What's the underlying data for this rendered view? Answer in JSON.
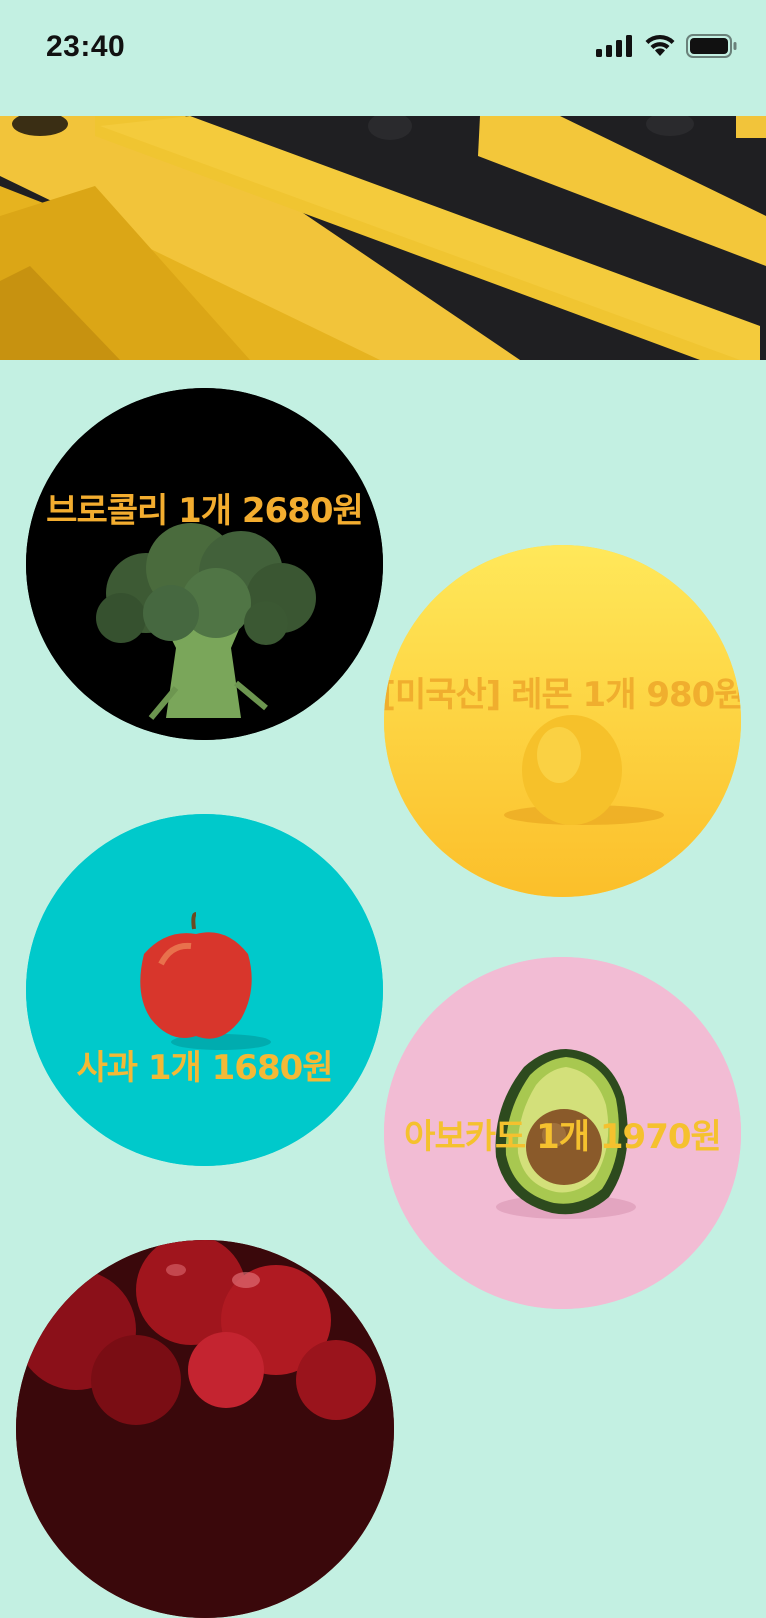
{
  "status_bar": {
    "time": "23:40",
    "icons": [
      "cellular-signal-icon",
      "wifi-icon",
      "battery-icon"
    ]
  },
  "banner": {
    "image": "yellow-black-stripes-banner"
  },
  "products": [
    {
      "label": "브로콜리 1개 2680원",
      "image": "broccoli-image",
      "label_color": "#f3ad2f",
      "bg": "#000000"
    },
    {
      "label": "[미국산] 레몬 1개 980원",
      "image": "lemon-image",
      "label_color": "#f0ae2e",
      "bg": "#ffd447"
    },
    {
      "label": "사과 1개 1680원",
      "image": "apple-image",
      "label_color": "#f3b936",
      "bg": "#00cccc"
    },
    {
      "label": "아보카도 1개 1970원",
      "image": "avocado-image",
      "label_color": "#f5c12e",
      "bg": "#f2bcd4"
    },
    {
      "label": "",
      "image": "cherries-image",
      "label_color": "#f3ad2f",
      "bg": "#6b0d12"
    }
  ],
  "colors": {
    "background": "#c3f0e2"
  }
}
